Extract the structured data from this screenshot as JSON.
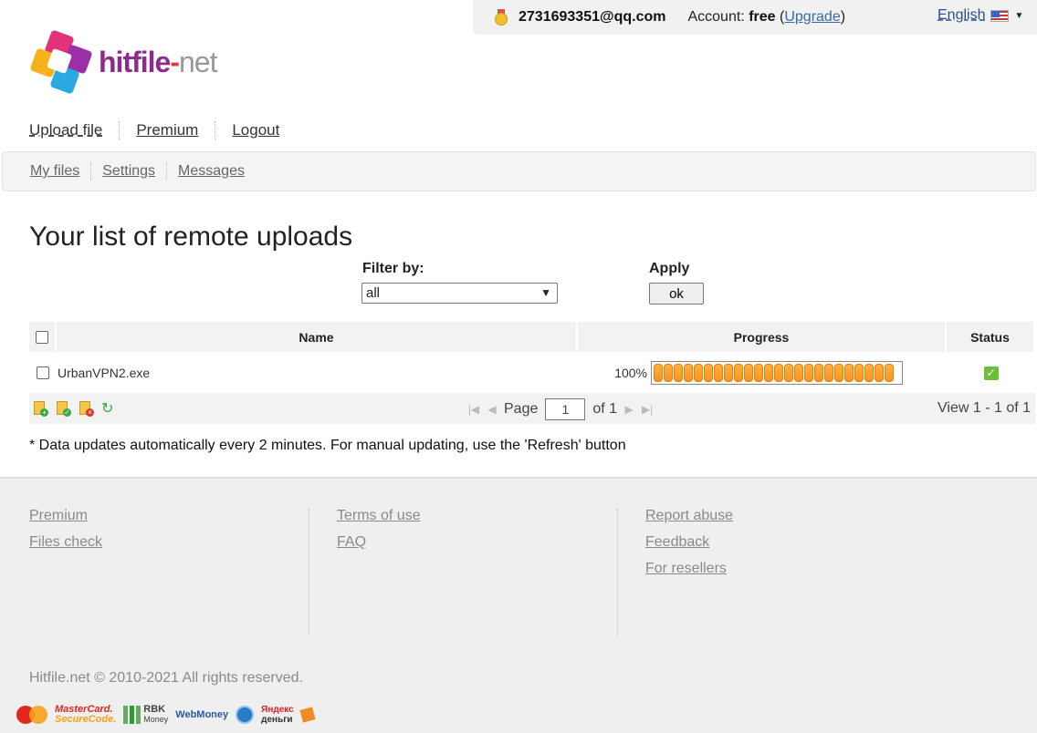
{
  "userbar": {
    "email": "2731693351@qq.com",
    "account_label": "Account:",
    "account_type": "free",
    "upgrade_open": "(",
    "upgrade": "Upgrade",
    "upgrade_close": ")",
    "language": "English"
  },
  "logo": {
    "part1": "hitfile",
    "part2": "-",
    "part3": "net"
  },
  "primary_nav": {
    "upload": "Upload file",
    "premium": "Premium",
    "logout": "Logout"
  },
  "secondary_nav": {
    "my_files": "My files",
    "settings": "Settings",
    "messages": "Messages"
  },
  "page": {
    "title": "Your list of remote uploads"
  },
  "filter": {
    "label": "Filter by:",
    "selected": "all",
    "apply_label": "Apply",
    "ok": "ok"
  },
  "table": {
    "headers": {
      "name": "Name",
      "progress": "Progress",
      "status": "Status"
    },
    "rows": [
      {
        "name": "UrbanVPN2.exe",
        "progress_text": "100%",
        "progress": 1.0,
        "status_icon": "check-icon"
      }
    ]
  },
  "pager": {
    "page_label": "Page",
    "page": "1",
    "of": "of 1",
    "view": "View 1 - 1 of 1"
  },
  "note": "* Data updates automatically every 2 minutes. For manual updating, use the 'Refresh' button",
  "footer": {
    "col1": [
      "Premium",
      "Files check"
    ],
    "col2": [
      "Terms of use",
      "FAQ"
    ],
    "col3": [
      "Report abuse",
      "Feedback",
      "For resellers"
    ],
    "copyright": "Hitfile.net © 2010-2021 All rights reserved.",
    "payments": {
      "mc_small": "MasterCard",
      "mc_secure_1": "MasterCard.",
      "mc_secure_2": "SecureCode.",
      "rbk_1": "RBK",
      "rbk_2": "Money",
      "webmoney": "WebMoney",
      "yandex_1": "Яндекс",
      "yandex_2": "деньги"
    }
  },
  "colors": {
    "progress": "#f7931e",
    "status_ok": "#6cbf3a",
    "logo_purple": "#8e2a8c"
  }
}
